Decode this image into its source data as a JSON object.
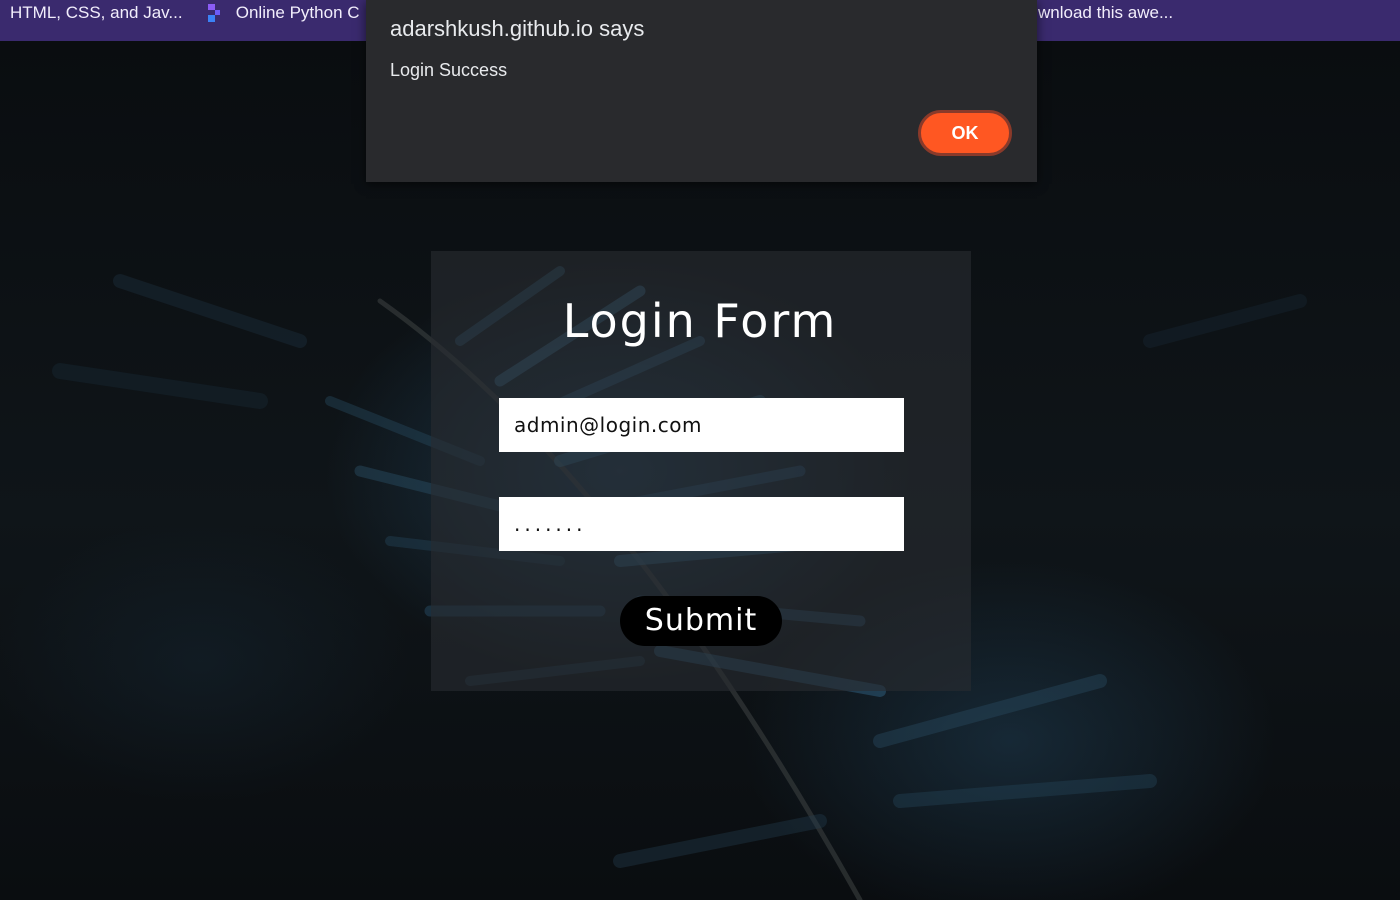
{
  "bookmarks": [
    {
      "label": "HTML, CSS, and Jav..."
    },
    {
      "label": "Online Python C",
      "icon": "replit-icon"
    },
    {
      "label": "wnload this awe..."
    }
  ],
  "dialog": {
    "title": "adarshkush.github.io says",
    "message": "Login Success",
    "ok_label": "OK"
  },
  "form": {
    "title": "Login Form",
    "email_value": "admin@login.com",
    "password_value": ".......",
    "submit_label": "Submit"
  },
  "colors": {
    "bookmarks_bar": "#3a2a6e",
    "dialog_bg": "#292a2d",
    "ok_button": "#ff5722",
    "submit_button": "#000000"
  }
}
